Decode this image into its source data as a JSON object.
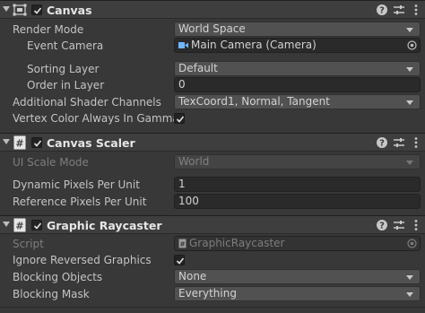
{
  "canvas": {
    "title": "Canvas",
    "enabled": true,
    "rows": [
      {
        "label": "Render Mode",
        "value": "World Space"
      },
      {
        "label": "Event Camera",
        "value": "Main Camera (Camera)"
      },
      {
        "label": "Sorting Layer",
        "value": "Default"
      },
      {
        "label": "Order in Layer",
        "value": "0"
      },
      {
        "label": "Additional Shader Channels",
        "value": "TexCoord1, Normal, Tangent"
      },
      {
        "label": "Vertex Color Always In Gamma Col",
        "checked": true
      }
    ]
  },
  "canvas_scaler": {
    "title": "Canvas Scaler",
    "enabled": true,
    "rows": [
      {
        "label": "UI Scale Mode",
        "value": "World"
      },
      {
        "label": "Dynamic Pixels Per Unit",
        "value": "1"
      },
      {
        "label": "Reference Pixels Per Unit",
        "value": "100"
      }
    ]
  },
  "graphic_raycaster": {
    "title": "Graphic Raycaster",
    "enabled": true,
    "rows": [
      {
        "label": "Script",
        "value": "GraphicRaycaster"
      },
      {
        "label": "Ignore Reversed Graphics",
        "checked": true
      },
      {
        "label": "Blocking Objects",
        "value": "None"
      },
      {
        "label": "Blocking Mask",
        "value": "Everything"
      }
    ]
  },
  "icons": [
    "fold-arrow-icon",
    "canvas-icon",
    "script-icon",
    "checkbox-icon",
    "help-icon",
    "presets-icon",
    "more-icon",
    "camera-icon",
    "object-picker-icon",
    "dropdown-caret-icon"
  ],
  "colors": {
    "background": "#383838",
    "header": "#3e3e3e",
    "field": "#2a2a2a",
    "dropdown": "#515151",
    "text": "#c4c4c4"
  }
}
